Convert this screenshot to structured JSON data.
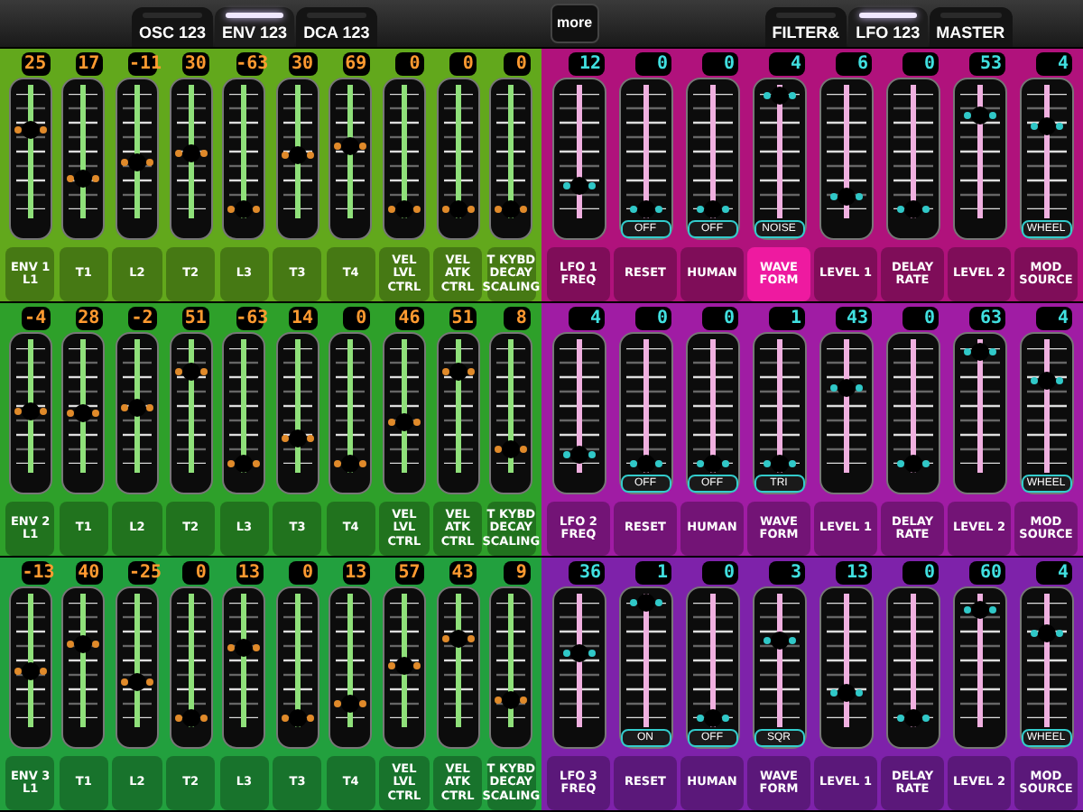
{
  "tabs_left": [
    {
      "label": "OSC 123",
      "selected": false
    },
    {
      "label": "ENV 123",
      "selected": true
    },
    {
      "label": "DCA 123",
      "selected": false
    }
  ],
  "more_button": "more",
  "tabs_right": [
    {
      "label": "FILTER&",
      "selected": false
    },
    {
      "label": "LFO 123",
      "selected": true
    },
    {
      "label": "MASTER",
      "selected": false
    }
  ],
  "panels": [
    {
      "kind": "env",
      "color": "#62a81c",
      "sliders": [
        {
          "value": "25",
          "level": 0.69,
          "label": "ENV 1\nL1",
          "selected": false
        },
        {
          "value": "17",
          "level": 0.27,
          "label": "T1",
          "selected": false
        },
        {
          "value": "-11",
          "level": 0.41,
          "label": "L2",
          "selected": false
        },
        {
          "value": "30",
          "level": 0.48,
          "label": "T2",
          "selected": false
        },
        {
          "value": "-63",
          "level": 0,
          "label": "L3",
          "selected": false
        },
        {
          "value": "30",
          "level": 0.47,
          "label": "T3",
          "selected": false
        },
        {
          "value": "69",
          "level": 0.54,
          "label": "T4",
          "selected": false
        },
        {
          "value": "0",
          "level": 0,
          "label": "VEL\nLVL\nCTRL",
          "selected": false
        },
        {
          "value": "0",
          "level": 0,
          "label": "VEL\nATK\nCTRL",
          "selected": false
        },
        {
          "value": "0",
          "level": 0,
          "label": "T KYBD\nDECAY\nSCALING",
          "selected": false
        }
      ]
    },
    {
      "kind": "lfo",
      "color": "#b0127c",
      "sliders": [
        {
          "value": "12",
          "level": 0.2,
          "label": "LFO 1\nFREQ",
          "selected": false
        },
        {
          "value": "0",
          "level": 0,
          "label": "RESET",
          "selected": false,
          "badge": "OFF"
        },
        {
          "value": "0",
          "level": 0,
          "label": "HUMAN",
          "selected": false,
          "badge": "OFF"
        },
        {
          "value": "4",
          "level": 0.98,
          "label": "WAVE\nFORM",
          "selected": true,
          "badge": "NOISE"
        },
        {
          "value": "6",
          "level": 0.11,
          "label": "LEVEL 1",
          "selected": false
        },
        {
          "value": "0",
          "level": 0,
          "label": "DELAY\nRATE",
          "selected": false
        },
        {
          "value": "53",
          "level": 0.82,
          "label": "LEVEL 2",
          "selected": false
        },
        {
          "value": "4",
          "level": 0.72,
          "label": "MOD\nSOURCE",
          "selected": false,
          "badge": "WHEEL"
        }
      ]
    },
    {
      "kind": "env",
      "color": "#2ea02a",
      "sliders": [
        {
          "value": "-4",
          "level": 0.46,
          "label": "ENV 2\nL1",
          "selected": false
        },
        {
          "value": "28",
          "level": 0.43,
          "label": "T1",
          "selected": false
        },
        {
          "value": "-2",
          "level": 0.48,
          "label": "L2",
          "selected": false
        },
        {
          "value": "51",
          "level": 0.79,
          "label": "T2",
          "selected": false
        },
        {
          "value": "-63",
          "level": 0,
          "label": "L3",
          "selected": false
        },
        {
          "value": "14",
          "level": 0.22,
          "label": "T3",
          "selected": false
        },
        {
          "value": "0",
          "level": 0,
          "label": "T4",
          "selected": false
        },
        {
          "value": "46",
          "level": 0.36,
          "label": "VEL\nLVL\nCTRL",
          "selected": false
        },
        {
          "value": "51",
          "level": 0.79,
          "label": "VEL\nATK\nCTRL",
          "selected": false
        },
        {
          "value": "8",
          "level": 0.12,
          "label": "T KYBD\nDECAY\nSCALING",
          "selected": false
        }
      ]
    },
    {
      "kind": "lfo",
      "color": "#a01ca4",
      "sliders": [
        {
          "value": "4",
          "level": 0.08,
          "label": "LFO 2\nFREQ",
          "selected": false
        },
        {
          "value": "0",
          "level": 0,
          "label": "RESET",
          "selected": false,
          "badge": "OFF"
        },
        {
          "value": "0",
          "level": 0,
          "label": "HUMAN",
          "selected": false,
          "badge": "OFF"
        },
        {
          "value": "1",
          "level": 0,
          "label": "WAVE\nFORM",
          "selected": false,
          "badge": "TRI"
        },
        {
          "value": "43",
          "level": 0.66,
          "label": "LEVEL 1",
          "selected": false
        },
        {
          "value": "0",
          "level": 0,
          "label": "DELAY\nRATE",
          "selected": false
        },
        {
          "value": "63",
          "level": 0.97,
          "label": "LEVEL 2",
          "selected": false
        },
        {
          "value": "4",
          "level": 0.72,
          "label": "MOD\nSOURCE",
          "selected": false,
          "badge": "WHEEL"
        }
      ]
    },
    {
      "kind": "env",
      "color": "#22a03e",
      "sliders": [
        {
          "value": "-13",
          "level": 0.4,
          "label": "ENV 3\nL1",
          "selected": false
        },
        {
          "value": "40",
          "level": 0.64,
          "label": "T1",
          "selected": false
        },
        {
          "value": "-25",
          "level": 0.31,
          "label": "L2",
          "selected": false
        },
        {
          "value": "0",
          "level": 0,
          "label": "T2",
          "selected": false
        },
        {
          "value": "13",
          "level": 0.61,
          "label": "L3",
          "selected": false
        },
        {
          "value": "0",
          "level": 0,
          "label": "T3",
          "selected": false
        },
        {
          "value": "13",
          "level": 0.12,
          "label": "T4",
          "selected": false
        },
        {
          "value": "57",
          "level": 0.46,
          "label": "VEL\nLVL\nCTRL",
          "selected": false
        },
        {
          "value": "43",
          "level": 0.69,
          "label": "VEL\nATK\nCTRL",
          "selected": false
        },
        {
          "value": "9",
          "level": 0.15,
          "label": "T KYBD\nDECAY\nSCALING",
          "selected": false
        }
      ]
    },
    {
      "kind": "lfo",
      "color": "#7e22aa",
      "sliders": [
        {
          "value": "36",
          "level": 0.57,
          "label": "LFO 3\nFREQ",
          "selected": false
        },
        {
          "value": "1",
          "level": 1,
          "label": "RESET",
          "selected": false,
          "badge": "ON"
        },
        {
          "value": "0",
          "level": 0,
          "label": "HUMAN",
          "selected": false,
          "badge": "OFF"
        },
        {
          "value": "3",
          "level": 0.67,
          "label": "WAVE\nFORM",
          "selected": false,
          "badge": "SQR"
        },
        {
          "value": "13",
          "level": 0.22,
          "label": "LEVEL 1",
          "selected": false
        },
        {
          "value": "0",
          "level": 0,
          "label": "DELAY\nRATE",
          "selected": false
        },
        {
          "value": "60",
          "level": 0.94,
          "label": "LEVEL 2",
          "selected": false
        },
        {
          "value": "4",
          "level": 0.73,
          "label": "MOD\nSOURCE",
          "selected": false,
          "badge": "WHEEL"
        }
      ]
    }
  ]
}
